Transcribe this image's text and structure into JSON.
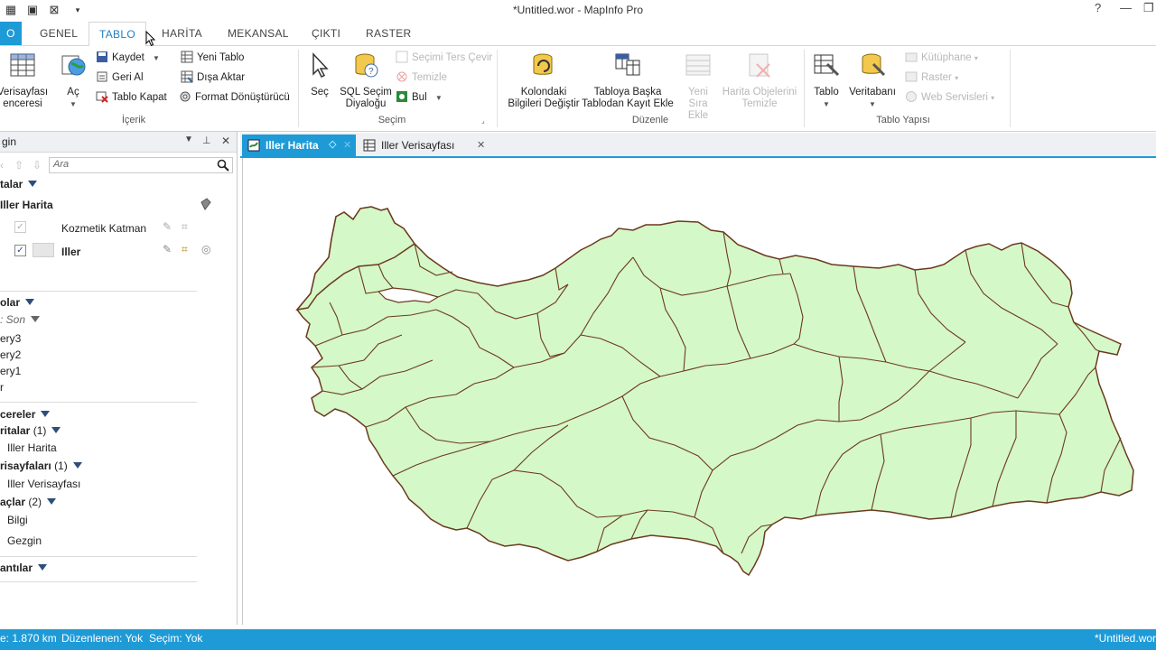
{
  "titlebar": {
    "title": "*Untitled.wor - MapInfo Pro",
    "help": "?",
    "minimize": "—",
    "restore": "❐"
  },
  "ribbon_tabs": [
    "O",
    "GENEL",
    "TABLO",
    "HARİTA",
    "MEKANSAL",
    "ÇIKTI",
    "RASTER"
  ],
  "active_tab": "TABLO",
  "ribbon": {
    "icerik": {
      "label": "İçerik",
      "verisayfasi": [
        "Verisayfası",
        "enceresi"
      ],
      "ac": "Aç",
      "kaydet": "Kaydet",
      "geri_al": "Geri Al",
      "tablo_kapat": "Tablo Kapat",
      "yeni_tablo": "Yeni Tablo",
      "disa_aktar": "Dışa Aktar",
      "format": "Format Dönüştürücü"
    },
    "secim": {
      "label": "Seçim",
      "sec": "Seç",
      "sql": [
        "SQL Seçim",
        "Diyaloğu"
      ],
      "ters": "Seçimi Ters Çevir",
      "temizle": "Temizle",
      "bul": "Bul"
    },
    "duzenle": {
      "label": "Düzenle",
      "kolon": [
        "Kolondaki",
        "Bilgileri Değiştir"
      ],
      "tabloya": [
        "Tabloya Başka",
        "Tablodan Kayıt Ekle"
      ],
      "yeni_sira": [
        "Yeni",
        "Sıra Ekle"
      ],
      "harita_obj": [
        "Harita Objelerini",
        "Temizle"
      ]
    },
    "yapi": {
      "label": "Tablo Yapısı",
      "tablo": "Tablo",
      "veritabani": "Veritabanı",
      "kutuphane": "Kütüphane",
      "raster": "Raster",
      "web": "Web Servisleri"
    }
  },
  "panel": {
    "title": "gin",
    "search_placeholder": "Ara",
    "haritalar": "talar",
    "map_name": "Iller Harita",
    "layers": [
      {
        "name": "Kozmetik Katman",
        "checked": true,
        "bold": false
      },
      {
        "name": "Iller",
        "checked": true,
        "bold": true
      }
    ],
    "sorgular": "olar",
    "sort": ": Son",
    "queries": [
      "ery3",
      "ery2",
      "ery1",
      "r"
    ],
    "pencereler": "cereler",
    "haritalar_count": "ritalar",
    "haritalar_n": "(1)",
    "win_map": "Iller Harita",
    "verisayfalari": "risayfaları",
    "verisayfalari_n": "(1)",
    "win_browser": "Iller Verisayfası",
    "araclar": "açlar",
    "araclar_n": "(2)",
    "tools": [
      "Bilgi",
      "Gezgin"
    ],
    "lejantlar": "antılar"
  },
  "doc_tabs": [
    {
      "label": "Iller Harita",
      "active": true
    },
    {
      "label": "Iller Verisayfası",
      "active": false
    }
  ],
  "status": {
    "zoom": "e: 1.870 km",
    "edit": "Düzenlenen: Yok",
    "selection": "Seçim: Yok",
    "workspace": "*Untitled.wor"
  },
  "colors": {
    "accent": "#1e9bd7",
    "map_fill": "#d5f8c8",
    "map_stroke": "#6b3a1f"
  }
}
